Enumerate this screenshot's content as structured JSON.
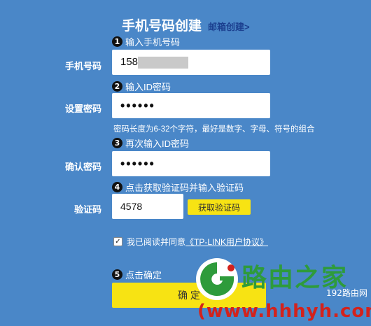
{
  "header": {
    "title": "手机号码创建",
    "email_link": "邮箱创建>"
  },
  "steps": [
    {
      "num": "1",
      "text": "输入手机号码"
    },
    {
      "num": "2",
      "text": "输入ID密码"
    },
    {
      "num": "3",
      "text": "再次输入ID密码"
    },
    {
      "num": "4",
      "text": "点击获取验证码并输入验证码"
    },
    {
      "num": "5",
      "text": "点击确定"
    }
  ],
  "form": {
    "phone_label": "手机号码",
    "phone_value": "158",
    "password_label": "设置密码",
    "password_value": "••••••",
    "password_hint": "密码长度为6-32个字符，最好是数字、字母、符号的组合",
    "confirm_label": "确认密码",
    "confirm_value": "••••••",
    "code_label": "验证码",
    "code_value": "4578",
    "get_code_label": "获取验证码"
  },
  "agreement": {
    "prefix": "我已阅读并同意",
    "link": "《TP-LINK用户协议》"
  },
  "confirm_button": "确 定",
  "watermark": {
    "cn": "路由之家",
    "url": "(www.hhhyh.com",
    "small": "192路由网"
  },
  "colors": {
    "background": "#4a87c8",
    "button": "#f7e313",
    "watermark_green": "#2e9b3b",
    "watermark_red": "#d3221c"
  }
}
